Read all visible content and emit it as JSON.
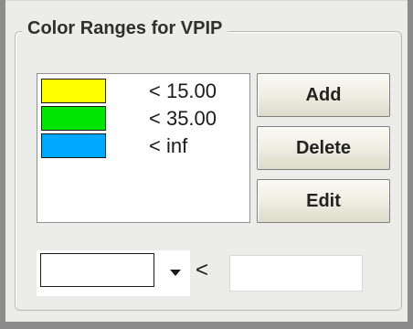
{
  "groupbox": {
    "title": "Color Ranges for VPIP"
  },
  "ranges": [
    {
      "color": "#ffff00",
      "label": "< 15.00"
    },
    {
      "color": "#00e600",
      "label": "< 35.00"
    },
    {
      "color": "#00a8ff",
      "label": "< inf"
    }
  ],
  "buttons": {
    "add": "Add",
    "delete": "Delete",
    "edit": "Edit"
  },
  "editor": {
    "selected_color": "#ffffff",
    "operator": "<",
    "threshold_value": ""
  }
}
